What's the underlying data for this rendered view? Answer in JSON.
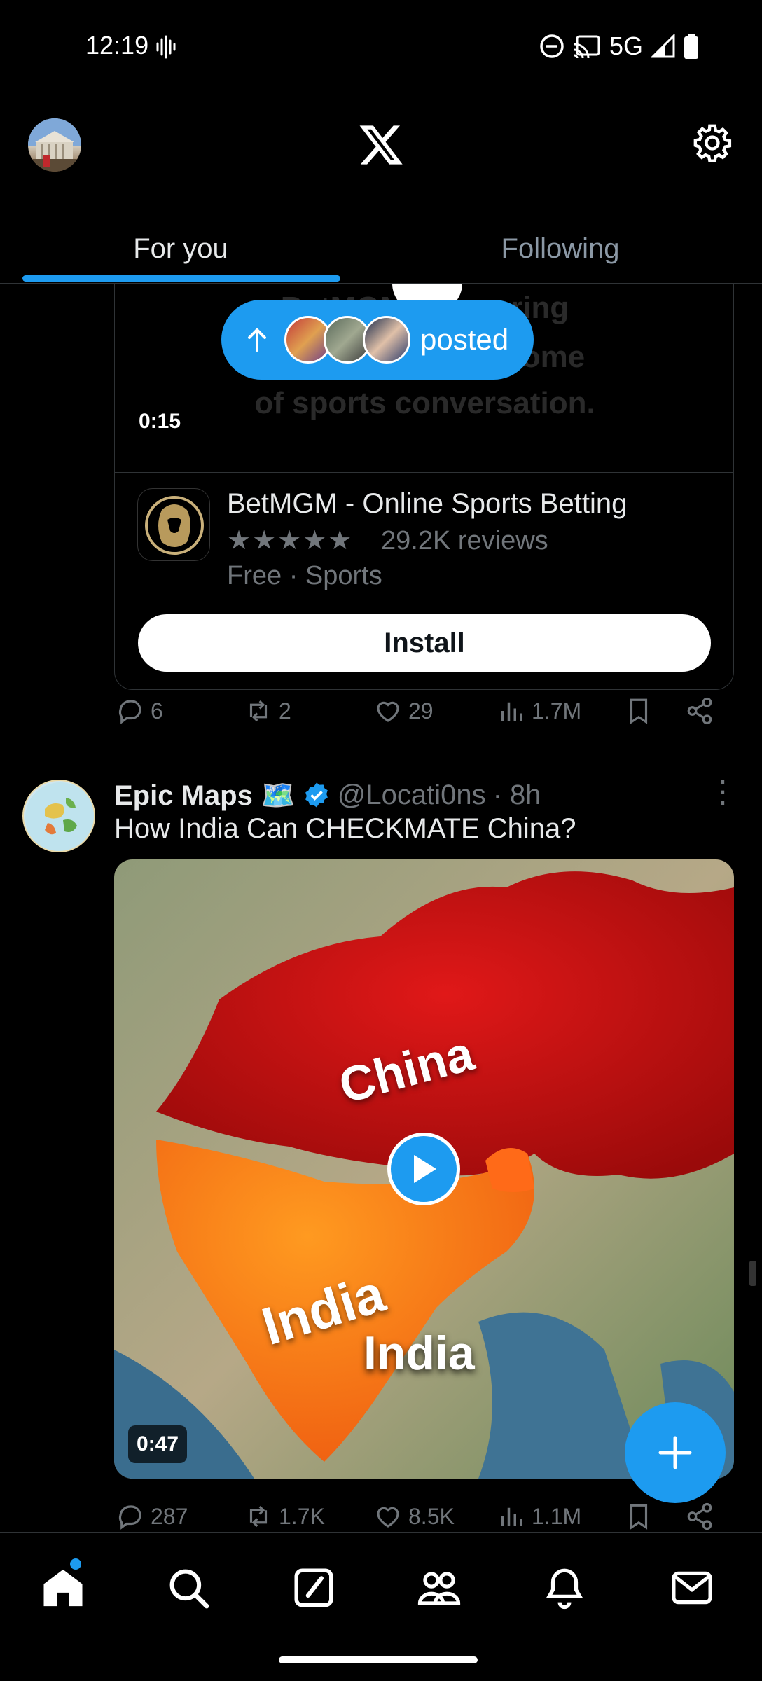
{
  "status_bar": {
    "time": "12:19",
    "network": "5G"
  },
  "header": {
    "tabs": [
      {
        "label": "For you"
      },
      {
        "label": "Following"
      }
    ]
  },
  "posted_pill": {
    "label": "posted"
  },
  "ad": {
    "video_text": [
      "BetMGM",
      "ring",
      "home",
      "of sports conversation."
    ],
    "duration": "0:15",
    "app_name": "BetMGM - Online Sports Betting",
    "stars": "★★★★★",
    "rating": 4.5,
    "reviews": "29.2K reviews",
    "meta": "Free · Sports",
    "install_label": "Install",
    "actions": {
      "replies": "6",
      "reposts": "2",
      "likes": "29",
      "views": "1.7M"
    }
  },
  "tweet": {
    "name": "Epic Maps 🗺️",
    "handle": "@Locati0ns",
    "time": "· 8h",
    "text": "How India Can CHECKMATE China?",
    "media": {
      "label_china": "China",
      "label_india_1": "India",
      "label_india_2": "India",
      "duration": "0:47"
    },
    "actions": {
      "replies": "287",
      "reposts": "1.7K",
      "likes": "8.5K",
      "views": "1.1M"
    }
  },
  "colors": {
    "accent": "#1d9bf0",
    "background": "#000000",
    "muted": "#71767b",
    "divider": "#2f3336"
  },
  "icons": [
    "search-icon",
    "compose-icon",
    "communities-icon",
    "notifications-icon",
    "messages-icon",
    "home-icon",
    "gear-icon",
    "x-logo-icon"
  ]
}
